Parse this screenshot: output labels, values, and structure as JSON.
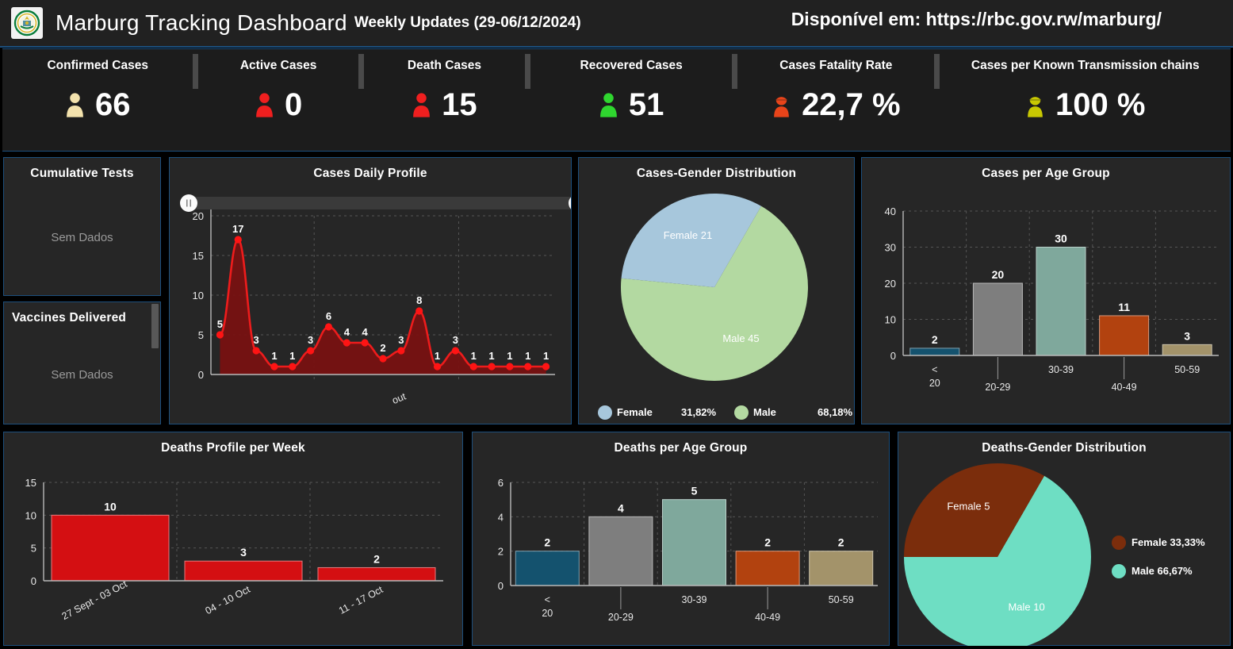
{
  "header": {
    "logo_alt": "rwanda-coat-of-arms",
    "title": "Marburg Tracking Dashboard",
    "subtitle": "Weekly Updates (29-06/12/2024)",
    "url_note": "Disponível em: https://rbc.gov.rw/marburg/"
  },
  "kpis": [
    {
      "label": "Confirmed Cases",
      "value": "66",
      "icon": "person-icon",
      "color": "#f3e2ad",
      "style": "plain"
    },
    {
      "label": "Active Cases",
      "value": "0",
      "icon": "person-icon",
      "color": "#ef1f1f",
      "style": "plain"
    },
    {
      "label": "Death Cases",
      "value": "15",
      "icon": "person-icon",
      "color": "#ef1f1f",
      "style": "plain"
    },
    {
      "label": "Recovered Cases",
      "value": "51",
      "icon": "person-icon",
      "color": "#2fd62f",
      "style": "plain"
    },
    {
      "label": "Cases Fatality Rate",
      "value": "22,7 %",
      "icon": "person-hat-icon",
      "color": "#e8441a",
      "style": "hat"
    },
    {
      "label": "Cases per Known Transmission chains",
      "value": "100 %",
      "icon": "person-hat-icon",
      "color": "#c8c802",
      "style": "hat"
    }
  ],
  "panels": {
    "cumulative_tests": {
      "title": "Cumulative Tests",
      "empty_text": "Sem Dados"
    },
    "vaccines_delivered": {
      "title": "Vaccines Delivered",
      "empty_text": "Sem Dados"
    }
  },
  "chart_data": [
    {
      "id": "cases-daily-profile",
      "type": "area",
      "title": "Cases Daily Profile",
      "xlabel": "out",
      "ylabel": "",
      "ylim": [
        0,
        20
      ],
      "yticks": [
        0,
        5,
        10,
        15,
        20
      ],
      "grid": true,
      "series_color": "#ee1c1c",
      "has_range_slider": true,
      "x": [
        1,
        2,
        3,
        4,
        5,
        6,
        7,
        8,
        9,
        10,
        11,
        12,
        13,
        14,
        15,
        16,
        17,
        18,
        19
      ],
      "values": [
        5,
        17,
        3,
        1,
        1,
        3,
        6,
        4,
        4,
        2,
        3,
        8,
        1,
        3,
        1,
        1,
        1,
        1,
        1
      ],
      "point_labels": [
        "5",
        "17",
        "3",
        "1",
        "1",
        "3",
        "6",
        "4",
        "4",
        "2",
        "3",
        "8",
        "1",
        "3",
        "1",
        "1",
        "1",
        "1",
        "1"
      ]
    },
    {
      "id": "cases-gender-distribution",
      "type": "pie",
      "title": "Cases-Gender Distribution",
      "slices": [
        {
          "name": "Male",
          "value": 45,
          "percent": "68,18%",
          "color": "#b3d9a1",
          "slice_label": "Male 45"
        },
        {
          "name": "Female",
          "value": 21,
          "percent": "31,82%",
          "color": "#a7c7dc",
          "slice_label": "Female 21"
        }
      ],
      "legend": [
        {
          "name": "Female",
          "percent": "31,82%",
          "color": "#a7c7dc"
        },
        {
          "name": "Male",
          "percent": "68,18%",
          "color": "#b3d9a1"
        }
      ],
      "legend_position": "bottom"
    },
    {
      "id": "cases-per-age-group",
      "type": "bar",
      "title": "Cases per Age Group",
      "categories": [
        "<\n20",
        "20-29",
        "30-39",
        "40-49",
        "50-59"
      ],
      "category_labels": [
        "< 20",
        "20-29",
        "30-39",
        "40-49",
        "50-59"
      ],
      "values": [
        2,
        20,
        30,
        11,
        3
      ],
      "colors": [
        "#14526e",
        "#7e7e7e",
        "#7fa89c",
        "#b2420f",
        "#a3936a"
      ],
      "ylim": [
        0,
        40
      ],
      "yticks": [
        0,
        10,
        20,
        30,
        40
      ],
      "grid": true,
      "xlabel": "",
      "ylabel": ""
    },
    {
      "id": "deaths-profile-per-week",
      "type": "bar",
      "title": "Deaths Profile per Week",
      "categories": [
        "27 Sept - 03 Oct",
        "04 - 10 Oct",
        "11 - 17 Oct"
      ],
      "values": [
        10,
        3,
        2
      ],
      "colors": [
        "#d40f12",
        "#d40f12",
        "#d40f12"
      ],
      "ylim": [
        0,
        15
      ],
      "yticks": [
        0,
        5,
        10,
        15
      ],
      "grid": true,
      "xlabel": "",
      "ylabel": ""
    },
    {
      "id": "deaths-per-age-group",
      "type": "bar",
      "title": "Deaths per Age Group",
      "categories": [
        "<\n20",
        "20-29",
        "30-39",
        "40-49",
        "50-59"
      ],
      "category_labels": [
        "< 20",
        "20-29",
        "30-39",
        "40-49",
        "50-59"
      ],
      "values": [
        2,
        4,
        5,
        2,
        2
      ],
      "colors": [
        "#14526e",
        "#7e7e7e",
        "#7fa89c",
        "#b2420f",
        "#a3936a"
      ],
      "ylim": [
        0,
        6
      ],
      "yticks": [
        0,
        2,
        4,
        6
      ],
      "grid": true,
      "xlabel": "",
      "ylabel": ""
    },
    {
      "id": "deaths-gender-distribution",
      "type": "pie",
      "title": "Deaths-Gender Distribution",
      "slices": [
        {
          "name": "Male",
          "value": 10,
          "percent": "66,67%",
          "color": "#6edec3",
          "slice_label": "Male 10"
        },
        {
          "name": "Female",
          "value": 5,
          "percent": "33,33%",
          "color": "#7b2d0c",
          "slice_label": "Female 5"
        }
      ],
      "legend": [
        {
          "name": "Female",
          "percent": "33,33%",
          "color": "#7b2d0c"
        },
        {
          "name": "Male",
          "percent": "66,67%",
          "color": "#6edec3"
        }
      ],
      "legend_position": "right"
    }
  ]
}
